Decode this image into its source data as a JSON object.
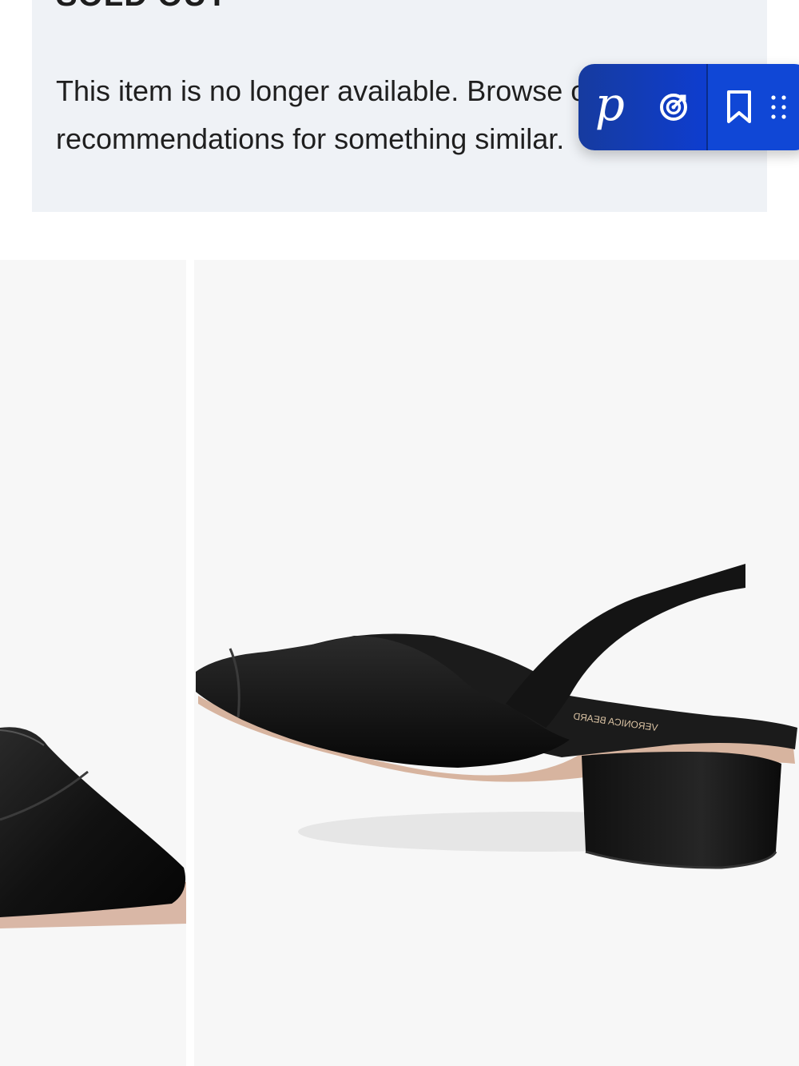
{
  "soldout": {
    "title": "SOLD OUT",
    "message": "This item is no longer available. Browse our recommendations for something similar."
  },
  "extension_toolbar": {
    "logo_letter": "p",
    "icons": [
      "target-icon",
      "bookmark-icon",
      "drag-handle-icon"
    ],
    "colors": {
      "left": "#163b9f",
      "right": "#1047d6"
    }
  },
  "gallery": {
    "images": [
      {
        "name": "product-image-front",
        "description_icon": "shoe-front-view"
      },
      {
        "name": "product-image-side",
        "description_icon": "shoe-side-view"
      }
    ],
    "insole_brand": "VERONICA BEARD"
  }
}
